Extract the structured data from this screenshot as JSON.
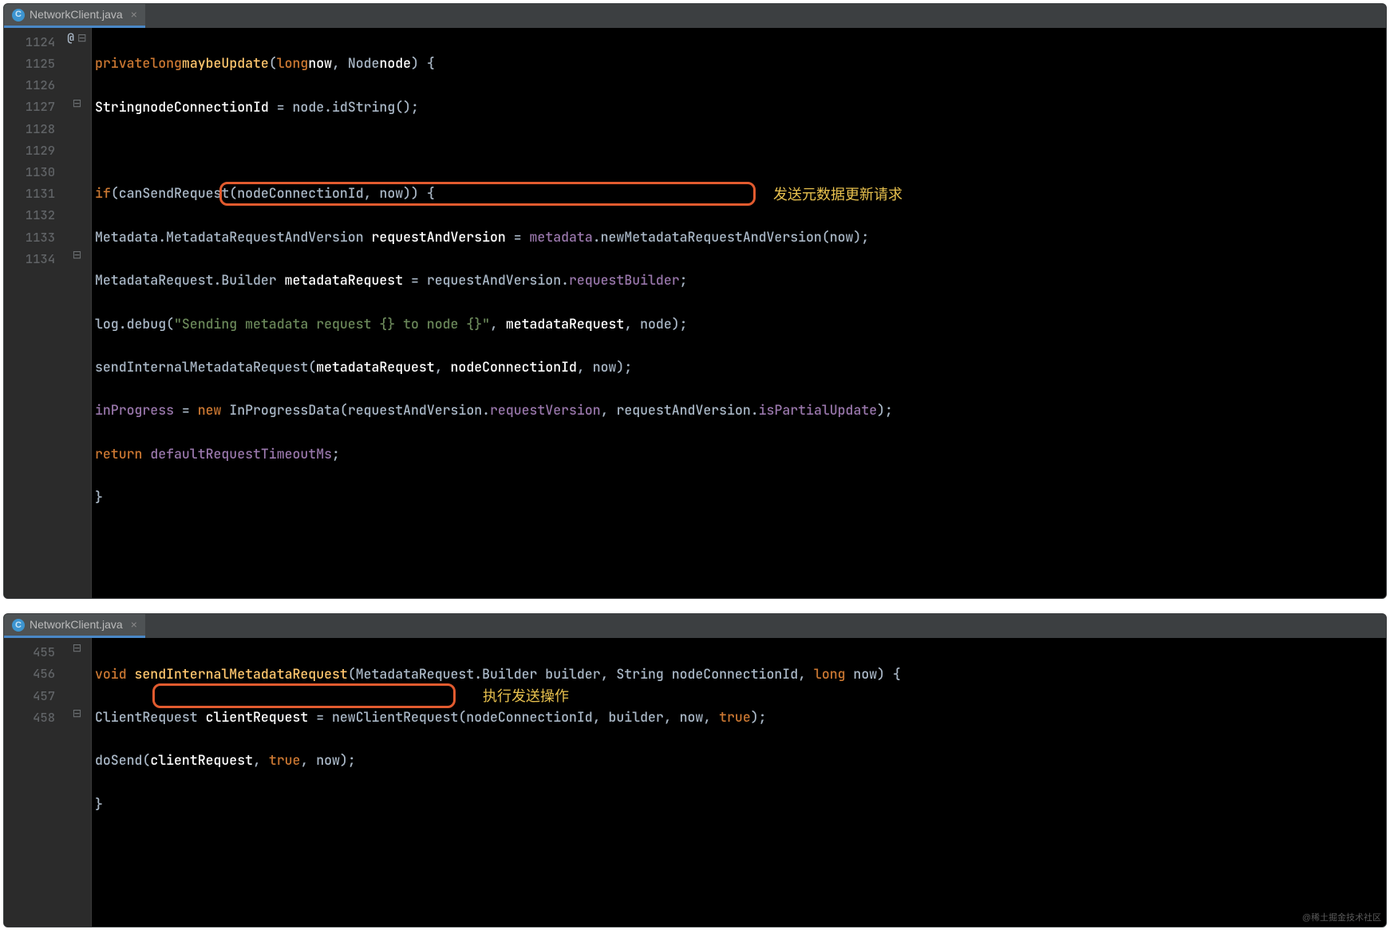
{
  "panel1": {
    "tab": {
      "filename": "NetworkClient.java"
    },
    "lineNumbers": [
      "1124",
      "1125",
      "1126",
      "1127",
      "1128",
      "1129",
      "1130",
      "1131",
      "1132",
      "1133",
      "1134"
    ],
    "markers": {
      "0": "@",
      "3fold": true,
      "10fold": true
    },
    "code": {
      "l1124_kw1": "private",
      "l1124_kw2": "long",
      "l1124_name": "maybeUpdate",
      "l1124_p1t": "long",
      "l1124_p1n": "now",
      "l1124_p2t": "Node",
      "l1124_p2n": "node",
      "l1124_brace": "{",
      "l1125_t": "String",
      "l1125_v": "nodeConnectionId",
      "l1125_eq": " = ",
      "l1125_rhs1": "node.idString();",
      "l1127_if": "if",
      "l1127_cond": "(canSendRequest(nodeConnectionId",
      "l1127_c2": ", ",
      "l1127_c3": "now)) {",
      "l1128_a": "Metadata.MetadataRequestAndVersion ",
      "l1128_b": "requestAndVersion",
      "l1128_c": " = ",
      "l1128_d": "metadata",
      "l1128_e": ".newMetadataRequestAndVersion(now);",
      "l1129_a": "MetadataRequest.Builder ",
      "l1129_b": "metadataRequest",
      "l1129_c": " = ",
      "l1129_d": "requestAndVersion.",
      "l1129_e": "requestBuilder",
      "l1129_f": ";",
      "l1130_a": "log.debug(",
      "l1130_s": "\"Sending metadata request {} to node {}\"",
      "l1130_b": ", ",
      "l1130_c": "metadataRequest",
      "l1130_d": ", ",
      "l1130_e": "node);",
      "l1131_a": "sendInternalMetadataRequest(",
      "l1131_b": "metadataRequest",
      "l1131_c": ", ",
      "l1131_d": "nodeConnectionId",
      "l1131_e": ", ",
      "l1131_f": "now);",
      "l1132_a": "inProgress ",
      "l1132_b": "= ",
      "l1132_c": "new ",
      "l1132_d": "InProgressData(",
      "l1132_e": "requestAndVersion.",
      "l1132_f": "requestVersion",
      "l1132_g": ", ",
      "l1132_h": "requestAndVersion.",
      "l1132_i": "isPartialUpdate",
      "l1132_j": ");",
      "l1133_a": "return ",
      "l1133_b": "defaultRequestTimeoutMs",
      "l1133_c": ";",
      "l1134": "}"
    },
    "annotation": "发送元数据更新请求"
  },
  "panel2": {
    "tab": {
      "filename": "NetworkClient.java"
    },
    "lineNumbers": [
      "455",
      "456",
      "457",
      "458"
    ],
    "code": {
      "l455_kw": "void ",
      "l455_name": "sendInternalMetadataRequest",
      "l455_rest": "(MetadataRequest.Builder builder, String nodeConnectionId, ",
      "l455_kw2": "long",
      "l455_rest2": " now) {",
      "l456_a": "ClientRequest ",
      "l456_b": "clientRequest",
      "l456_c": " = newClientRequest(nodeConnectionId, builder, now, ",
      "l456_d": "true",
      "l456_e": ");",
      "l457_a": "doSend(",
      "l457_b": "clientRequest",
      "l457_c": ", ",
      "l457_d": "true",
      "l457_e": ", ",
      "l457_f": "now);",
      "l458": "}"
    },
    "annotation": "执行发送操作",
    "watermark": "@稀土掘金技术社区"
  }
}
